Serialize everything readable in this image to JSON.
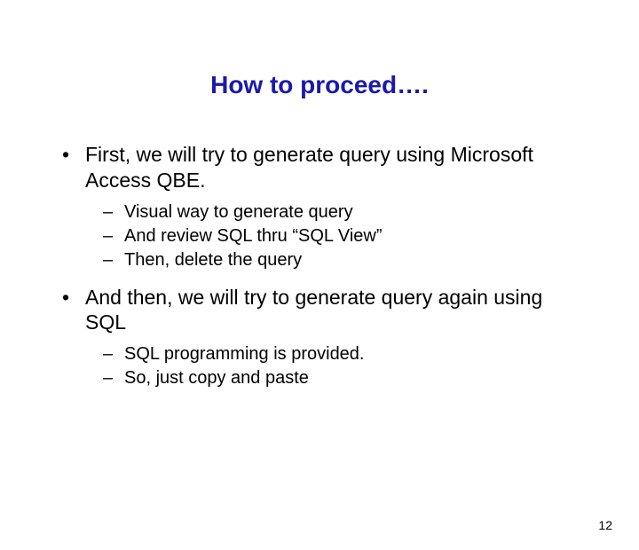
{
  "title": "How to proceed….",
  "bullets": [
    {
      "text": "First, we will try to generate query using Microsoft Access QBE.",
      "subs": [
        "Visual way to generate query",
        "And review SQL thru “SQL View”",
        "Then, delete the query"
      ]
    },
    {
      "text": "And then, we will try to generate query again using SQL",
      "subs": [
        "SQL programming is provided.",
        "So, just copy and paste"
      ]
    }
  ],
  "page_number": "12"
}
